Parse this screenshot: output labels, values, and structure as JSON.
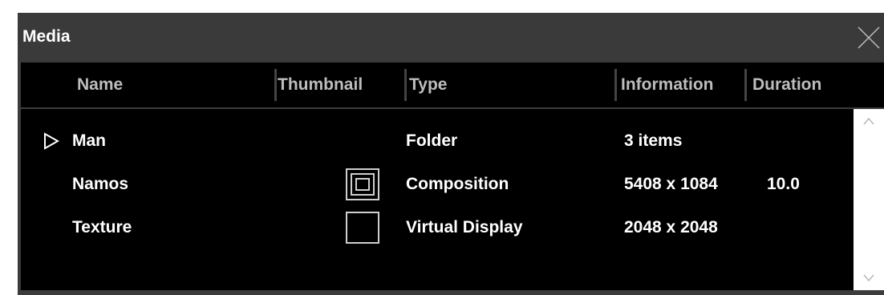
{
  "panel": {
    "title": "Media",
    "close_icon": "close-icon"
  },
  "columns": [
    "Name",
    "Thumbnail",
    "Type",
    "Information",
    "Duration"
  ],
  "rows": [
    {
      "name": "Man",
      "type": "Folder",
      "information": "3 items",
      "duration": "",
      "expandable": true,
      "thumbnail": "none"
    },
    {
      "name": "Namos",
      "type": "Composition",
      "information": "5408 x 1084",
      "duration": "10.0",
      "expandable": false,
      "thumbnail": "composition-icon"
    },
    {
      "name": "Texture",
      "type": "Virtual Display",
      "information": "2048 x 2048",
      "duration": "",
      "expandable": false,
      "thumbnail": "empty-box"
    }
  ],
  "colors": {
    "panel_bg": "#3a3a3a",
    "list_bg": "#000000",
    "header_text": "#bdbdbd",
    "row_text": "#ffffff"
  }
}
